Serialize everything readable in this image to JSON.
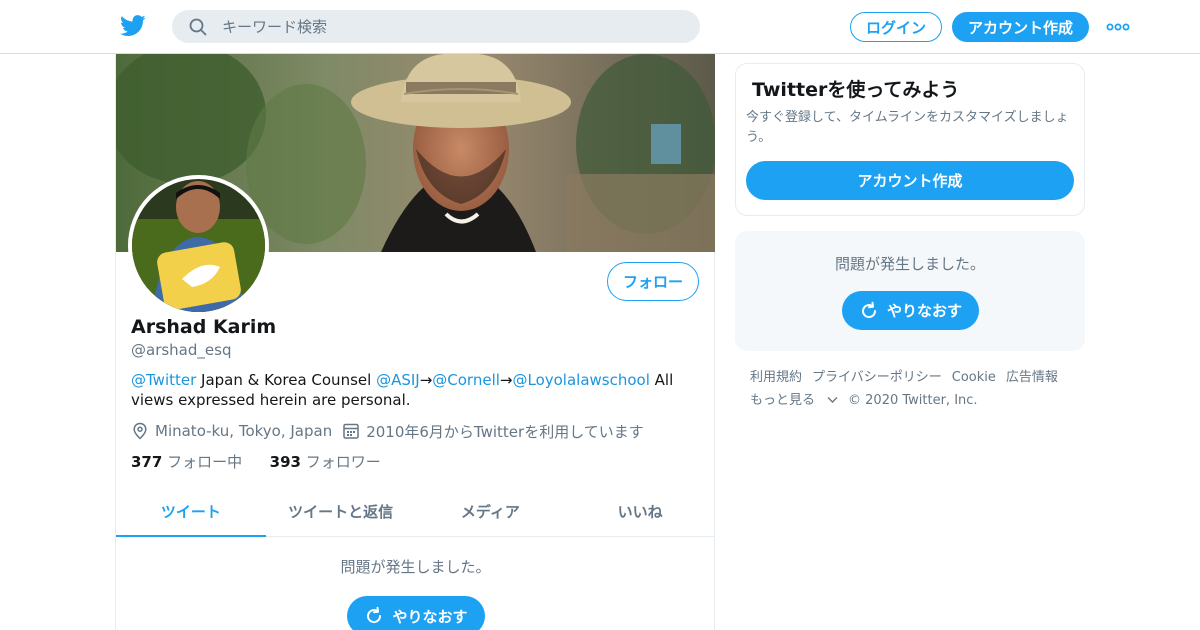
{
  "header": {
    "search_placeholder": "キーワード検索",
    "login_label": "ログイン",
    "signup_label": "アカウント作成"
  },
  "profile": {
    "name": "Arshad Karim",
    "handle": "@arshad_esq",
    "follow_label": "フォロー",
    "bio": [
      {
        "text": "@Twitter",
        "link": true
      },
      {
        "text": " Japan & Korea Counsel ",
        "link": false
      },
      {
        "text": "@ASIJ",
        "link": true
      },
      {
        "text": "→",
        "link": false
      },
      {
        "text": "@Cornell",
        "link": true
      },
      {
        "text": "→",
        "link": false
      },
      {
        "text": "@Loyolalawschool",
        "link": true
      },
      {
        "text": " All views expressed herein are personal.",
        "link": false
      }
    ],
    "location": "Minato-ku, Tokyo, Japan",
    "joined": "2010年6月からTwitterを利用しています",
    "following_count": "377",
    "following_label": "フォロー中",
    "followers_count": "393",
    "followers_label": "フォロワー"
  },
  "tabs": [
    {
      "label": "ツイート",
      "active": true
    },
    {
      "label": "ツイートと返信",
      "active": false
    },
    {
      "label": "メディア",
      "active": false
    },
    {
      "label": "いいね",
      "active": false
    }
  ],
  "timeline": {
    "error_text": "問題が発生しました。",
    "retry_label": "やりなおす"
  },
  "sidebar": {
    "signup_card": {
      "title": "Twitterを使ってみよう",
      "description": "今すぐ登録して、タイムラインをカスタマイズしましょう。",
      "button_label": "アカウント作成"
    },
    "error_card": {
      "message": "問題が発生しました。",
      "retry_label": "やりなおす"
    },
    "footer": {
      "links": [
        "利用規約",
        "プライバシーポリシー",
        "Cookie",
        "広告情報"
      ],
      "more_label": "もっと見る",
      "copyright": "© 2020 Twitter, Inc."
    }
  },
  "colors": {
    "accent": "#1da1f2",
    "link": "#1b95e0",
    "secondary_text": "#657786",
    "border": "#e6ecf0"
  },
  "icons": [
    "twitter-bird-icon",
    "search-icon",
    "more-dots-icon",
    "location-pin-icon",
    "calendar-icon",
    "refresh-icon",
    "chevron-down-icon"
  ]
}
